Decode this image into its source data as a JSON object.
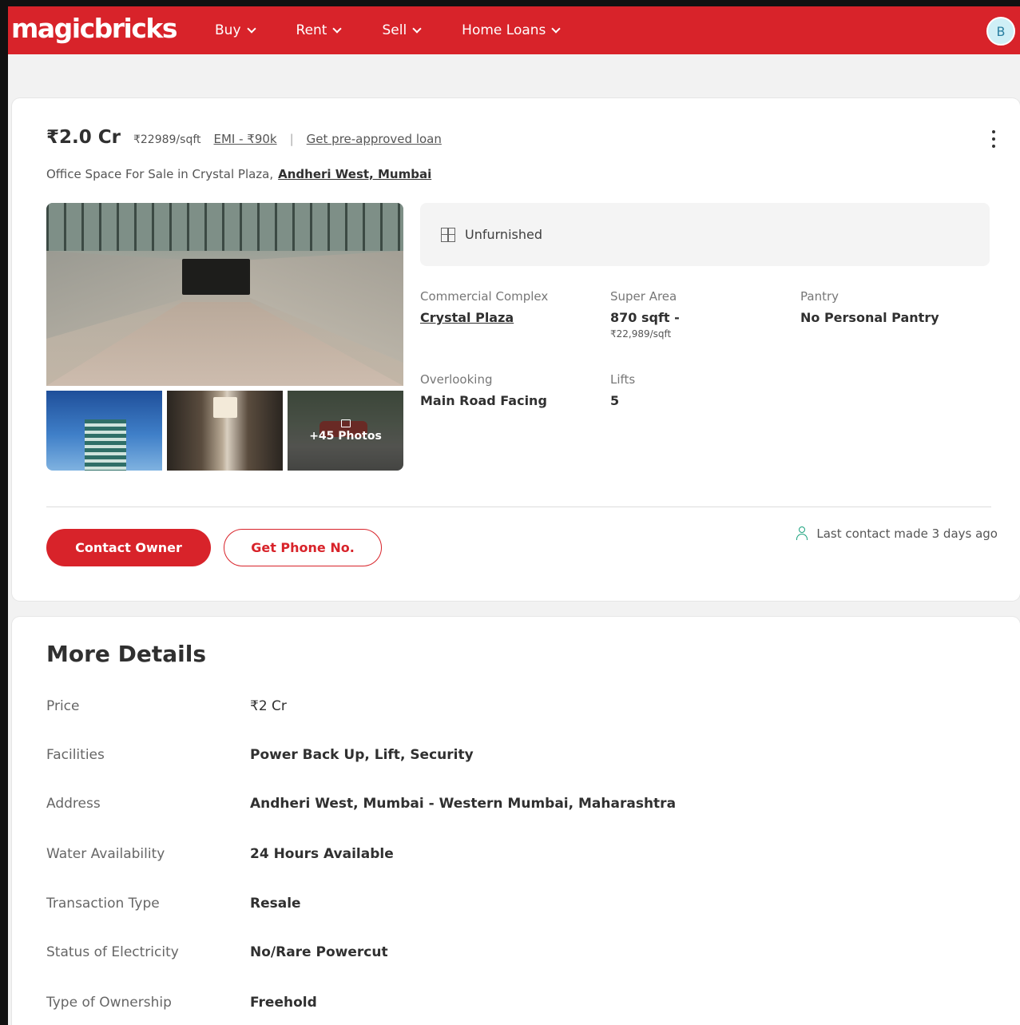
{
  "header": {
    "logo": "magicbricks",
    "nav": [
      "Buy",
      "Rent",
      "Sell",
      "Home Loans"
    ],
    "avatar_initial": "B",
    "brand_color": "#d8232a"
  },
  "listing": {
    "price": "₹2.0 Cr",
    "price_per_sqft": "₹22989/sqft",
    "emi": "EMI - ₹90k",
    "separator": "|",
    "loan_link": "Get pre-approved loan",
    "subtitle": "Office Space For Sale in Crystal Plaza,",
    "location": "Andheri West, Mumbai",
    "photos_more": "+45 Photos",
    "furnishing": "Unfurnished",
    "summary": {
      "complex_label": "Commercial Complex",
      "complex_value": "Crystal Plaza",
      "area_label": "Super Area",
      "area_value": "870 sqft -",
      "area_sub": "₹22,989/sqft",
      "pantry_label": "Pantry",
      "pantry_value": "No Personal Pantry",
      "overlooking_label": "Overlooking",
      "overlooking_value": "Main Road Facing",
      "lifts_label": "Lifts",
      "lifts_value": "5"
    },
    "contact_button": "Contact Owner",
    "phone_button": "Get Phone No.",
    "last_contact": "Last contact made 3 days ago"
  },
  "details": {
    "title": "More Details",
    "rows": [
      {
        "label": "Price",
        "value": "₹2 Cr"
      },
      {
        "label": "Facilities",
        "value": "Power Back Up, Lift, Security"
      },
      {
        "label": "Address",
        "value": "Andheri West, Mumbai - Western Mumbai, Maharashtra"
      },
      {
        "label": "Water Availability",
        "value": "24 Hours Available"
      },
      {
        "label": "Transaction Type",
        "value": "Resale"
      },
      {
        "label": "Status of Electricity",
        "value": "No/Rare Powercut"
      },
      {
        "label": "Type of Ownership",
        "value": "Freehold"
      }
    ]
  }
}
